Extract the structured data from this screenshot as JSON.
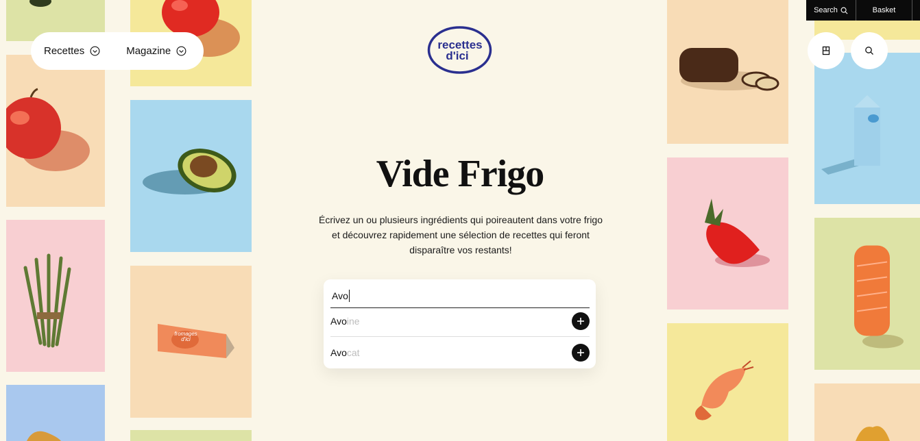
{
  "topbar": {
    "search_label": "Search",
    "basket_label": "Basket"
  },
  "nav": {
    "items": [
      {
        "label": "Recettes"
      },
      {
        "label": "Magazine"
      }
    ]
  },
  "logo": {
    "line1": "recettes",
    "line2": "d'ici"
  },
  "actions": {
    "saved_icon": "bookmark-icon",
    "search_icon": "search-icon"
  },
  "hero": {
    "title": "Vide Frigo",
    "description": "Écrivez un ou plusieurs ingrédients qui poireautent dans votre frigo et découvrez rapidement une sélection de recettes qui feront disparaître vos restants!"
  },
  "search": {
    "value": "Avo",
    "suggestions": [
      {
        "match": "Avo",
        "rest": "ine"
      },
      {
        "match": "Avo",
        "rest": "cat"
      }
    ]
  },
  "tiles": {
    "cheese_label_line1": "fromages",
    "cheese_label_line2": "d'ici"
  },
  "colors": {
    "background": "#faf6e8",
    "brand_blue": "#2a2f8f",
    "tile_yellow": "#f5e89a",
    "tile_peach": "#f8dcb6",
    "tile_pink": "#f8cfd2",
    "tile_blue": "#a9d8ee",
    "tile_green": "#dde3a6"
  }
}
